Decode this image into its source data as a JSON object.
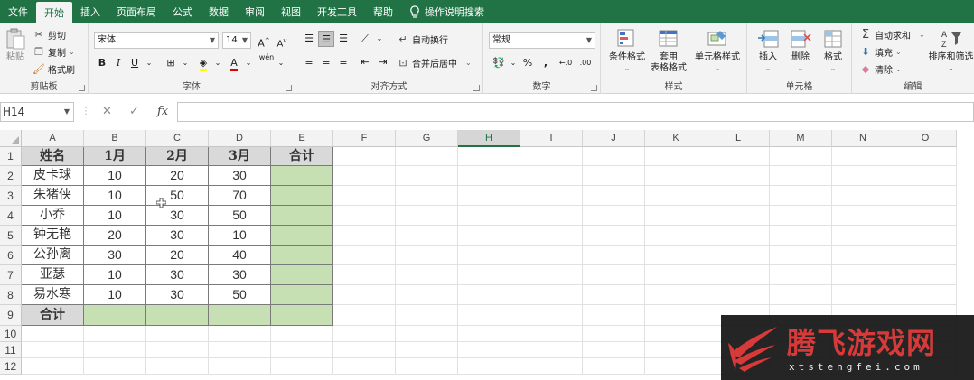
{
  "tabs": [
    "文件",
    "开始",
    "插入",
    "页面布局",
    "公式",
    "数据",
    "审阅",
    "视图",
    "开发工具",
    "帮助"
  ],
  "active_tab": "开始",
  "tell_me": "操作说明搜索",
  "clipboard": {
    "paste": "粘贴",
    "cut": "剪切",
    "copy": "复制",
    "format_painter": "格式刷",
    "label": "剪贴板"
  },
  "font": {
    "name": "宋体",
    "size": "14",
    "bold": "B",
    "italic": "I",
    "underline": "U",
    "font_color_glyph": "A",
    "phonetic": "wén",
    "label": "字体"
  },
  "alignment": {
    "wrap": "自动换行",
    "merge": "合并后居中",
    "label": "对齐方式"
  },
  "number": {
    "format": "常规",
    "percent": "%",
    "comma": ",",
    "label": "数字"
  },
  "styles": {
    "conditional": "条件格式",
    "table_line1": "套用",
    "table_line2": "表格格式",
    "cell_styles": "单元格样式",
    "label": "样式"
  },
  "cells": {
    "insert": "插入",
    "delete": "删除",
    "format": "格式",
    "label": "单元格"
  },
  "editing": {
    "autosum": "自动求和",
    "fill": "填充",
    "clear": "清除",
    "sort": "排序和筛选",
    "label": "编辑"
  },
  "formula_bar": {
    "name_box": "H14",
    "fx": "fx",
    "value": ""
  },
  "colors": {
    "brand": "#217346",
    "header_fill": "#d9d9d9",
    "total_fill": "#c6e0b4",
    "watermark_red": "#d83a3a"
  },
  "columns": [
    "A",
    "B",
    "C",
    "D",
    "E",
    "F",
    "G",
    "H",
    "I",
    "J",
    "K",
    "L",
    "M",
    "N",
    "O"
  ],
  "selected_column": "H",
  "row_numbers": [
    "1",
    "2",
    "3",
    "4",
    "5",
    "6",
    "7",
    "8",
    "9",
    "10",
    "11",
    "12"
  ],
  "table": {
    "header": [
      "姓名",
      "1月",
      "2月",
      "3月",
      "合计"
    ],
    "rows": [
      [
        "皮卡球",
        "10",
        "20",
        "30",
        ""
      ],
      [
        "朱猪侠",
        "10",
        "50",
        "70",
        ""
      ],
      [
        "小乔",
        "10",
        "30",
        "50",
        ""
      ],
      [
        "钟无艳",
        "20",
        "30",
        "10",
        ""
      ],
      [
        "公孙离",
        "30",
        "20",
        "40",
        ""
      ],
      [
        "亚瑟",
        "10",
        "30",
        "30",
        ""
      ],
      [
        "易水寒",
        "10",
        "30",
        "50",
        ""
      ]
    ],
    "total_row": [
      "合计",
      "",
      "",
      "",
      ""
    ]
  },
  "watermark": {
    "title": "腾飞游戏网",
    "url": "xtstengfei.com"
  }
}
